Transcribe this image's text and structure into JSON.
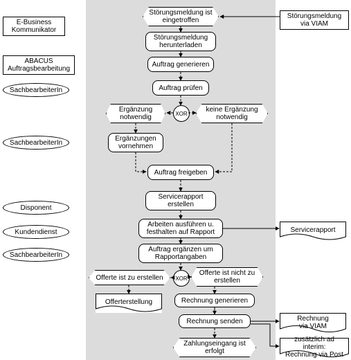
{
  "roles": {
    "r1": "E-Business\nKommunikator",
    "r2": "ABACUS\nAuftragsbearbeitung",
    "r3": "SachbearbeiterIn",
    "r4": "SachbearbeiterIn",
    "r5": "Disponent",
    "r6": "Kundendienst",
    "r7": "SachbearbeiterIn"
  },
  "right": {
    "in1": "Störungsmeldung\nvia VIAM",
    "doc1": "Servicerapport",
    "doc2": "Rechnung\nvia VIAM",
    "doc3": "zusätzlich ad interim:\nRechnung via Post"
  },
  "flow": {
    "e1": "Störungsmeldung\nist eingetroffen",
    "f1": "Störungsmeldung\nherunterladen",
    "f2": "Auftrag generieren",
    "f3": "Auftrag prüfen",
    "xor1": "XOR",
    "e2": "Ergänzung\nnotwendig",
    "e3": "keine Ergänzung\nnotwendig",
    "f4": "Ergänzungen\nvornehmen",
    "f5": "Auftrag freigeben",
    "f6": "Servicerapport\nerstellen",
    "f7": "Arbeiten ausführen u.\nfesthalten auf Rapport",
    "f8": "Auftrag ergänzen um\nRapportangaben",
    "xor2": "XOR",
    "e4": "Offerte ist zu erstellen",
    "e5": "Offerte ist nicht\nzu erstellen",
    "p1": "Offerterstellung",
    "f9": "Rechnung generieren",
    "f10": "Rechnung senden",
    "e6": "Zahlungseingang\nist erfolgt"
  },
  "chart_data": {
    "type": "epc-flowchart",
    "title": "",
    "lanes_left": [
      {
        "id": "r1",
        "type": "system",
        "label": "E-Business Kommunikator"
      },
      {
        "id": "r2",
        "type": "system",
        "label": "ABACUS Auftragsbearbeitung"
      },
      {
        "id": "r3",
        "type": "role",
        "label": "SachbearbeiterIn"
      },
      {
        "id": "r4",
        "type": "role",
        "label": "SachbearbeiterIn"
      },
      {
        "id": "r5",
        "type": "role",
        "label": "Disponent"
      },
      {
        "id": "r6",
        "type": "role",
        "label": "Kundendienst"
      },
      {
        "id": "r7",
        "type": "role",
        "label": "SachbearbeiterIn"
      }
    ],
    "lanes_right": [
      {
        "id": "in1",
        "type": "input",
        "label": "Störungsmeldung via VIAM"
      },
      {
        "id": "doc1",
        "type": "document",
        "label": "Servicerapport"
      },
      {
        "id": "doc2",
        "type": "document",
        "label": "Rechnung via VIAM"
      },
      {
        "id": "doc3",
        "type": "document",
        "label": "zusätzlich ad interim: Rechnung via Post"
      }
    ],
    "nodes": [
      {
        "id": "e1",
        "type": "event",
        "label": "Störungsmeldung ist eingetroffen"
      },
      {
        "id": "f1",
        "type": "function",
        "label": "Störungsmeldung herunterladen"
      },
      {
        "id": "f2",
        "type": "function",
        "label": "Auftrag generieren"
      },
      {
        "id": "f3",
        "type": "function",
        "label": "Auftrag prüfen"
      },
      {
        "id": "xor1",
        "type": "xor",
        "label": "XOR"
      },
      {
        "id": "e2",
        "type": "event",
        "label": "Ergänzung notwendig"
      },
      {
        "id": "e3",
        "type": "event",
        "label": "keine Ergänzung notwendig"
      },
      {
        "id": "f4",
        "type": "function",
        "label": "Ergänzungen vornehmen"
      },
      {
        "id": "f5",
        "type": "function",
        "label": "Auftrag freigeben"
      },
      {
        "id": "f6",
        "type": "function",
        "label": "Servicerapport erstellen"
      },
      {
        "id": "f7",
        "type": "function",
        "label": "Arbeiten ausführen u. festhalten auf Rapport"
      },
      {
        "id": "f8",
        "type": "function",
        "label": "Auftrag ergänzen um Rapportangaben"
      },
      {
        "id": "xor2",
        "type": "xor",
        "label": "XOR"
      },
      {
        "id": "e4",
        "type": "event",
        "label": "Offerte ist zu erstellen"
      },
      {
        "id": "e5",
        "type": "event",
        "label": "Offerte ist nicht zu erstellen"
      },
      {
        "id": "p1",
        "type": "process",
        "label": "Offerterstellung"
      },
      {
        "id": "f9",
        "type": "function",
        "label": "Rechnung generieren"
      },
      {
        "id": "f10",
        "type": "function",
        "label": "Rechnung senden"
      },
      {
        "id": "e6",
        "type": "event",
        "label": "Zahlungseingang ist erfolgt"
      }
    ],
    "edges": [
      {
        "from": "in1",
        "to": "e1",
        "style": "solid"
      },
      {
        "from": "e1",
        "to": "f1",
        "style": "dashed"
      },
      {
        "from": "f1",
        "to": "f2",
        "style": "solid"
      },
      {
        "from": "f2",
        "to": "f3",
        "style": "dashed"
      },
      {
        "from": "f3",
        "to": "xor1",
        "style": "dashed"
      },
      {
        "from": "xor1",
        "to": "e2",
        "style": "dashed"
      },
      {
        "from": "xor1",
        "to": "e3",
        "style": "dashed"
      },
      {
        "from": "e2",
        "to": "f4",
        "style": "dashed"
      },
      {
        "from": "f4",
        "to": "f5",
        "style": "dashed"
      },
      {
        "from": "e3",
        "to": "f5",
        "style": "dashed"
      },
      {
        "from": "f5",
        "to": "f6",
        "style": "dashed"
      },
      {
        "from": "f6",
        "to": "f7",
        "style": "dashed"
      },
      {
        "from": "f7",
        "to": "f8",
        "style": "dashed"
      },
      {
        "from": "f7",
        "to": "doc1",
        "style": "solid"
      },
      {
        "from": "f8",
        "to": "xor2",
        "style": "dashed"
      },
      {
        "from": "xor2",
        "to": "e4",
        "style": "dashed"
      },
      {
        "from": "xor2",
        "to": "e5",
        "style": "dashed"
      },
      {
        "from": "e4",
        "to": "p1",
        "style": "dashed"
      },
      {
        "from": "e5",
        "to": "f9",
        "style": "dashed"
      },
      {
        "from": "f9",
        "to": "f10",
        "style": "solid"
      },
      {
        "from": "f10",
        "to": "e6",
        "style": "dashed"
      },
      {
        "from": "f10",
        "to": "doc2",
        "style": "solid"
      },
      {
        "from": "f10",
        "to": "doc3",
        "style": "solid"
      }
    ]
  }
}
